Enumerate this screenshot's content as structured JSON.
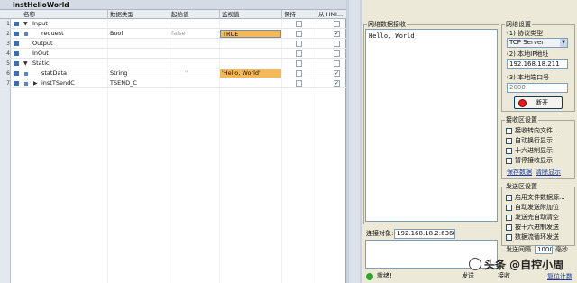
{
  "left": {
    "title": "InstHelloWorld",
    "headers": {
      "name": "名称",
      "datatype": "数据类型",
      "start": "起始值",
      "monitor": "监视值",
      "retain": "保持",
      "from": "从 HMI..."
    },
    "rows": [
      {
        "num": "1",
        "name": "Input",
        "type": "",
        "start": "",
        "monitor": ""
      },
      {
        "num": "2",
        "name": "request",
        "type": "Bool",
        "start": "false",
        "monitor": "TRUE"
      },
      {
        "num": "3",
        "name": "Output",
        "type": "",
        "start": "",
        "monitor": ""
      },
      {
        "num": "4",
        "name": "InOut",
        "type": "",
        "start": "",
        "monitor": ""
      },
      {
        "num": "5",
        "name": "Static",
        "type": "",
        "start": "",
        "monitor": ""
      },
      {
        "num": "6",
        "name": "statData",
        "type": "String",
        "start": "''",
        "monitor": "'Hello, World'"
      },
      {
        "num": "7",
        "name": "instTSendC",
        "type": "TSEND_C",
        "start": "",
        "monitor": ""
      }
    ]
  },
  "right": {
    "recv_group": "网络数据接收",
    "recv_text": "Hello, World",
    "net_group": "网络设置",
    "protocol_label": "(1) 协议类型",
    "protocol_value": "TCP Server",
    "ip_label": "(2) 本地IP地址",
    "ip_value": "192.168.18.211",
    "port_label": "(3) 本地端口号",
    "port_value": "2000",
    "disconnect": "断开",
    "recv_set_group": "接收区设置",
    "recv_options": [
      "接收转向文件...",
      "自动换行显示",
      "十六进制显示",
      "暂停接收显示"
    ],
    "save_data": "保存数据",
    "clear_display": "清除显示",
    "send_set_group": "发送区设置",
    "send_options": [
      "启用文件数据源...",
      "自动发送附加位",
      "发送完自动清空",
      "按十六进制发送",
      "数据流循环发送"
    ],
    "conn_label": "连接对象:",
    "conn_value": "192.168.18.2:6366",
    "interval_label": "发送间隔",
    "interval_value": "1000",
    "interval_unit": "毫秒",
    "status_text": "就绪!",
    "send_count": "发送",
    "recv_count": "接收",
    "reset_count": "复位计数",
    "watermark": "头条 @自控小周"
  }
}
